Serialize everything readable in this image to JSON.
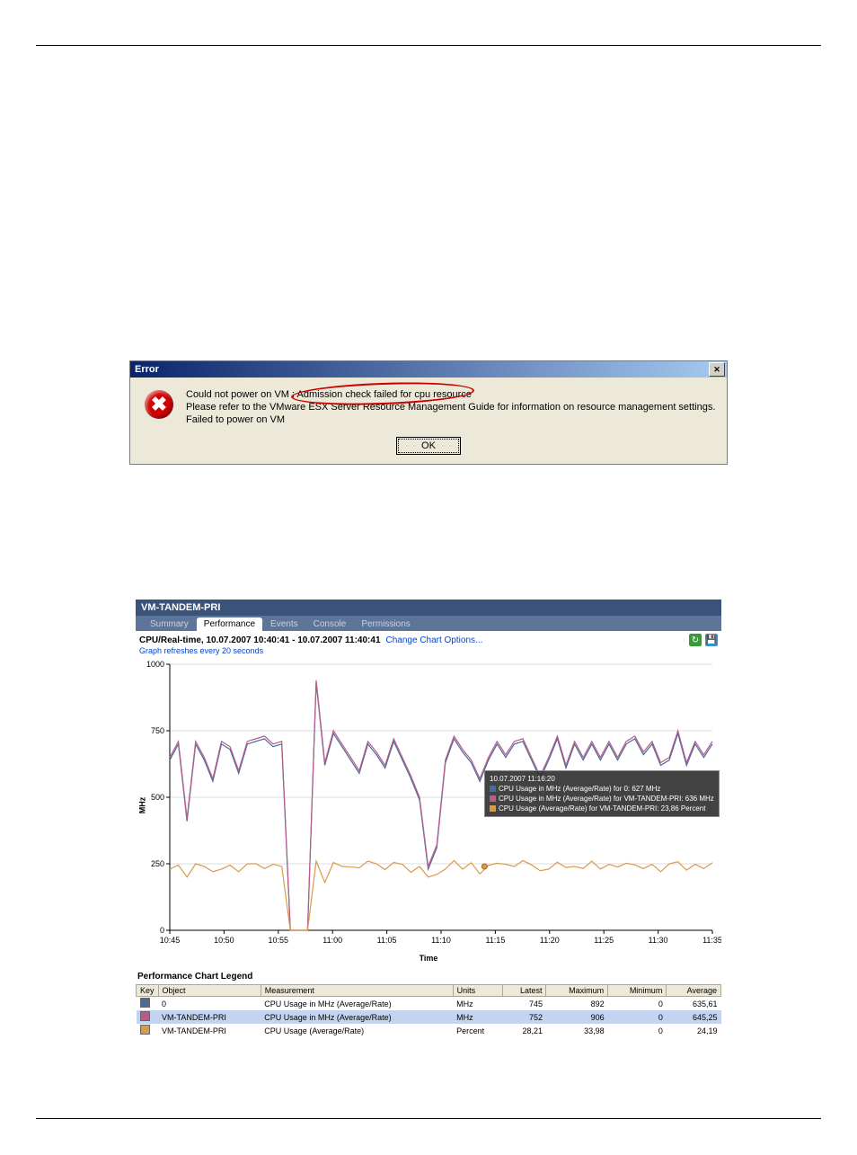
{
  "dialog": {
    "title": "Error",
    "line1_prefix": "Could not power on VM : ",
    "line1_highlight": "Admission check failed for cpu resource",
    "line2": "Please refer to the VMware ESX Server Resource Management Guide for information on resource management settings.",
    "line3": "Failed to power on VM",
    "ok": "OK"
  },
  "vm": {
    "name": "VM-TANDEM-PRI",
    "tabs": [
      "Summary",
      "Performance",
      "Events",
      "Console",
      "Permissions"
    ],
    "active_tab": "Performance",
    "chart_title": "CPU/Real-time, 10.07.2007 10:40:41 - 10.07.2007 11:40:41",
    "change_link": "Change Chart Options...",
    "refresh_note": "Graph refreshes every 20 seconds",
    "ylabel": "MHz",
    "xlabel": "Time",
    "legend_title": "Performance Chart Legend",
    "tooltip": {
      "time": "10.07.2007 11:16:20",
      "l1": "CPU Usage in MHz (Average/Rate) for 0: 627 MHz",
      "l2": "CPU Usage in MHz (Average/Rate) for VM-TANDEM-PRI: 636 MHz",
      "l3": "CPU Usage (Average/Rate) for VM-TANDEM-PRI: 23,86 Percent"
    },
    "legend_headers": [
      "Key",
      "Object",
      "Measurement",
      "Units",
      "Latest",
      "Maximum",
      "Minimum",
      "Average"
    ],
    "legend_rows": [
      {
        "color": "#4a6a9a",
        "obj": "0",
        "meas": "CPU Usage in MHz (Average/Rate)",
        "units": "MHz",
        "latest": "745",
        "max": "892",
        "min": "0",
        "avg": "635,61"
      },
      {
        "color": "#b85c8a",
        "obj": "VM-TANDEM-PRI",
        "meas": "CPU Usage in MHz (Average/Rate)",
        "units": "MHz",
        "latest": "752",
        "max": "906",
        "min": "0",
        "avg": "645,25"
      },
      {
        "color": "#d99a4a",
        "obj": "VM-TANDEM-PRI",
        "meas": "CPU Usage (Average/Rate)",
        "units": "Percent",
        "latest": "28,21",
        "max": "33,98",
        "min": "0",
        "avg": "24,19"
      }
    ]
  },
  "chart_data": {
    "type": "line",
    "title": "CPU/Real-time",
    "xlabel": "Time",
    "ylabel": "MHz",
    "ylim": [
      0,
      1000
    ],
    "x_ticks": [
      "10:45",
      "10:50",
      "10:55",
      "11:00",
      "11:05",
      "11:10",
      "11:15",
      "11:20",
      "11:25",
      "11:30",
      "11:35"
    ],
    "y_ticks": [
      0,
      250,
      500,
      750,
      1000
    ],
    "series": [
      {
        "name": "CPU Usage in MHz 0",
        "color": "#4a6a9a",
        "values": [
          640,
          700,
          410,
          700,
          640,
          560,
          700,
          680,
          590,
          700,
          710,
          720,
          690,
          700,
          0,
          0,
          0,
          930,
          620,
          740,
          690,
          640,
          590,
          700,
          660,
          610,
          710,
          640,
          570,
          490,
          230,
          310,
          630,
          720,
          670,
          630,
          560,
          640,
          700,
          650,
          700,
          710,
          640,
          570,
          640,
          720,
          610,
          700,
          640,
          700,
          640,
          700,
          640,
          700,
          720,
          660,
          700,
          620,
          640,
          740,
          620,
          700,
          650,
          700
        ]
      },
      {
        "name": "CPU Usage in MHz VM-TANDEM-PRI",
        "color": "#b85c8a",
        "values": [
          650,
          710,
          420,
          710,
          650,
          570,
          710,
          690,
          600,
          710,
          720,
          730,
          700,
          710,
          0,
          0,
          0,
          940,
          630,
          750,
          700,
          650,
          600,
          710,
          670,
          620,
          720,
          650,
          580,
          500,
          240,
          320,
          640,
          730,
          680,
          640,
          570,
          650,
          710,
          660,
          710,
          720,
          650,
          580,
          650,
          730,
          620,
          710,
          650,
          710,
          650,
          710,
          650,
          710,
          730,
          670,
          710,
          630,
          650,
          750,
          630,
          710,
          660,
          710
        ]
      },
      {
        "name": "CPU Usage % VM-TANDEM-PRI",
        "color": "#d99a4a",
        "values": [
          230,
          245,
          200,
          250,
          240,
          220,
          230,
          245,
          220,
          250,
          250,
          232,
          248,
          240,
          0,
          0,
          0,
          260,
          180,
          255,
          240,
          238,
          235,
          260,
          250,
          228,
          255,
          248,
          218,
          240,
          200,
          210,
          230,
          262,
          230,
          254,
          212,
          244,
          252,
          248,
          240,
          262,
          246,
          224,
          230,
          256,
          236,
          240,
          232,
          260,
          230,
          248,
          238,
          252,
          246,
          232,
          248,
          220,
          250,
          258,
          226,
          248,
          232,
          254
        ]
      }
    ]
  }
}
